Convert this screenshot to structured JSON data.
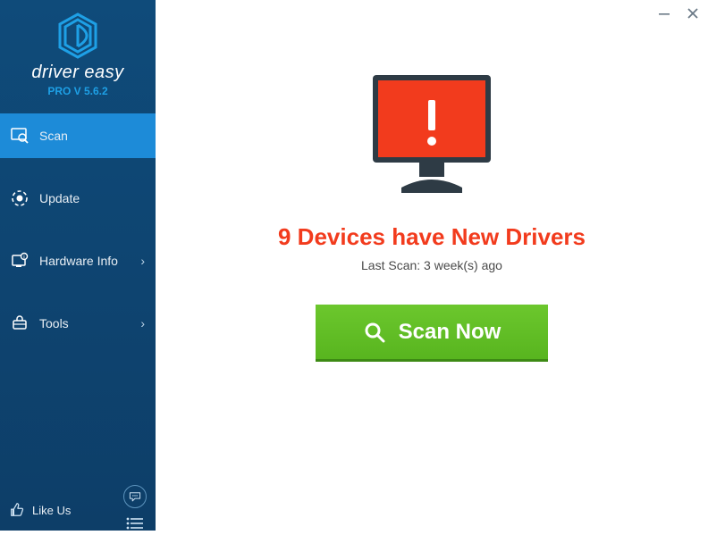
{
  "brand": {
    "name": "driver easy",
    "version": "PRO V 5.6.2"
  },
  "sidebar": {
    "items": [
      {
        "label": "Scan"
      },
      {
        "label": "Update"
      },
      {
        "label": "Hardware Info"
      },
      {
        "label": "Tools"
      }
    ],
    "like_label": "Like Us"
  },
  "main": {
    "headline": "9 Devices have New Drivers",
    "last_scan": "Last Scan: 3 week(s) ago",
    "scan_button": "Scan Now"
  }
}
